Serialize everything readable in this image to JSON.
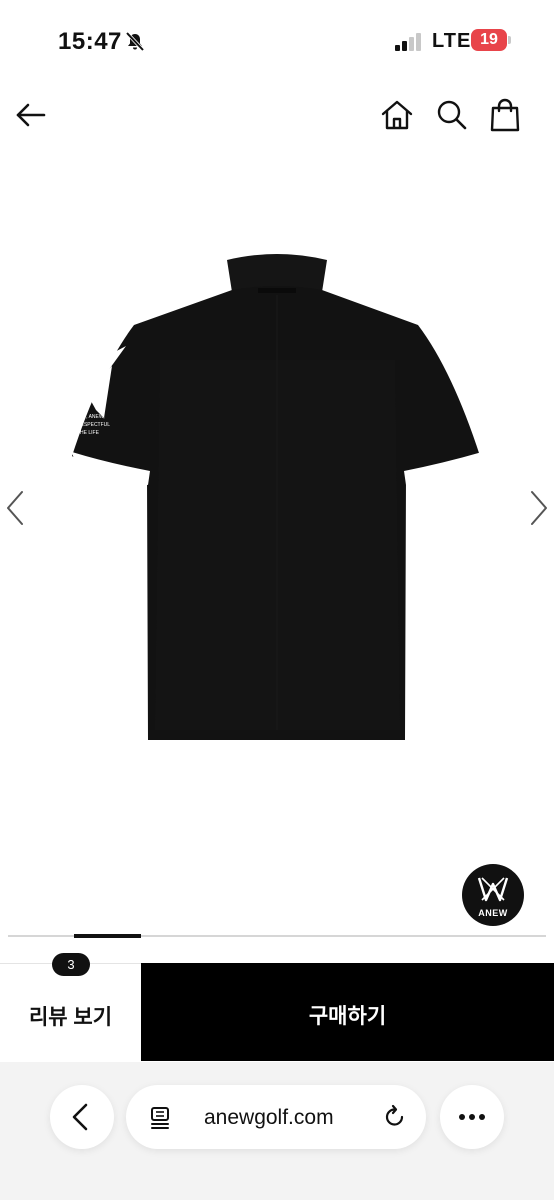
{
  "status_bar": {
    "time": "15:47",
    "network": "LTE",
    "battery": "19",
    "icons": [
      "bell-slash-icon",
      "signal-icon",
      "battery-icon"
    ]
  },
  "top_nav": {
    "icons": [
      "back-arrow-icon",
      "home-icon",
      "search-icon",
      "shopping-bag-icon"
    ]
  },
  "product": {
    "image": "black polo shirt back view",
    "carousel_progress": 0.125
  },
  "brand_badge": {
    "label": "ANEW"
  },
  "actions": {
    "review_label": "리뷰 보기",
    "review_count": "3",
    "buy_label": "구매하기"
  },
  "browser": {
    "url": "anewgolf.com",
    "icons": [
      "browser-back-icon",
      "reader-icon",
      "reload-icon",
      "more-icon"
    ]
  },
  "colors": {
    "battery_red": "#e8444a",
    "shirt": "#111111",
    "accent": "#000000"
  }
}
